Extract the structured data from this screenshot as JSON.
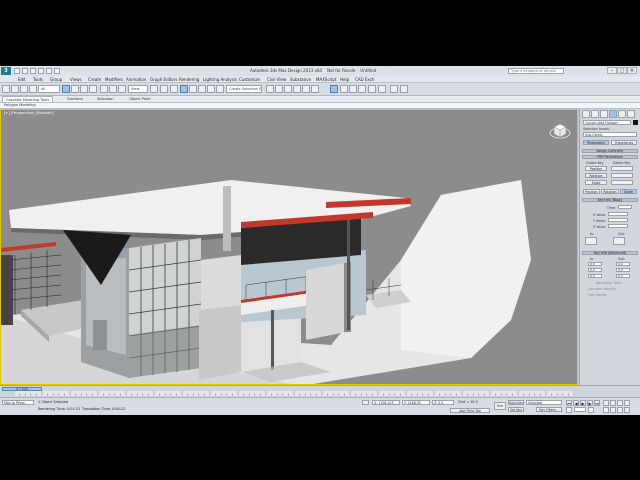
{
  "window": {
    "title": "Autodesk 3ds Max Design 2013 x64",
    "subtitle": "Not for Resale",
    "file": "Untitled",
    "search_placeholder": "Type a keyword or phrase",
    "app_logo": "3ds-max-logo",
    "minimize": "–",
    "maximize": "□",
    "close": "✕"
  },
  "menu": [
    "Edit",
    "Tools",
    "Group",
    "Views",
    "Create",
    "Modifiers",
    "Animation",
    "Graph Editors",
    "Rendering",
    "Lighting Analysis",
    "Customize",
    "Civil View",
    "Substance",
    "MAXScript",
    "Help",
    "CAD Exch"
  ],
  "toolbar": {
    "selection_filter": "All",
    "coord_system": "View",
    "named_selection": "Create Selection Se"
  },
  "ribbon": {
    "tabs": [
      "Graphite Modeling Tools",
      "Freeform",
      "Selection",
      "Object Paint"
    ],
    "active_tab": "Graphite Modeling Tools",
    "panel_label": "Polygon Modeling"
  },
  "viewport": {
    "label": "[+] [Perspective] [Realistic]"
  },
  "command_panel": {
    "object_name": "Curtain Wall Hallway",
    "selection_level_label": "Selection Levels:",
    "selection_level_value": "Sub-Object",
    "params_btn": "Parameters",
    "trajectories_btn": "Trajectories",
    "rollout_assign": "Assign Controller",
    "rollout_prs": "PRS Parameters",
    "create_key": "Create Key",
    "delete_key": "Delete Key",
    "position": "Position",
    "rotation": "Rotation",
    "scale": "Scale",
    "sub_position": "Position",
    "sub_rotation": "Rotation",
    "sub_scale": "Scale",
    "rollout_key_basic": "Key Info (Basic)",
    "time_label": "Time:",
    "x_value": "X Value:",
    "y_value": "Y Value:",
    "z_value": "Z Value:",
    "in_label": "In:",
    "out_label": "Out:",
    "rollout_key_adv": "Key Info (Advanced)",
    "in_label2": "In:",
    "out_label2": "Out:",
    "spin_x": "0.0",
    "spin_y": "0.0",
    "spin_z": "0.0",
    "normalize_time": "Normalize Time",
    "constant_velocity": "Constant Velocity",
    "free_handle": "Free Handle"
  },
  "timeline": {
    "frame": "0 / 100",
    "ticks": [
      "0",
      "5",
      "10",
      "15",
      "20",
      "25",
      "30",
      "35",
      "40",
      "45",
      "50",
      "55",
      "60",
      "65",
      "70",
      "75",
      "80",
      "85",
      "90",
      "95",
      "100"
    ]
  },
  "status": {
    "maxscript": "Max to Physc.",
    "objects_selected": "1 Object Selected",
    "rendering_time": "Rendering Time: 0:01:22",
    "translation_time": "Translation Time: 0:00:22",
    "x": "X: 1106.103",
    "y": "Y: 2168.35",
    "z": "Z: 0.0",
    "grid": "Grid = 10.0",
    "auto_key": "Auto Key",
    "set_key": "Set Key",
    "selected": "Selected",
    "key_filters": "Key Filters...",
    "add_time_tag": "Add Time Tag",
    "one": "One"
  }
}
